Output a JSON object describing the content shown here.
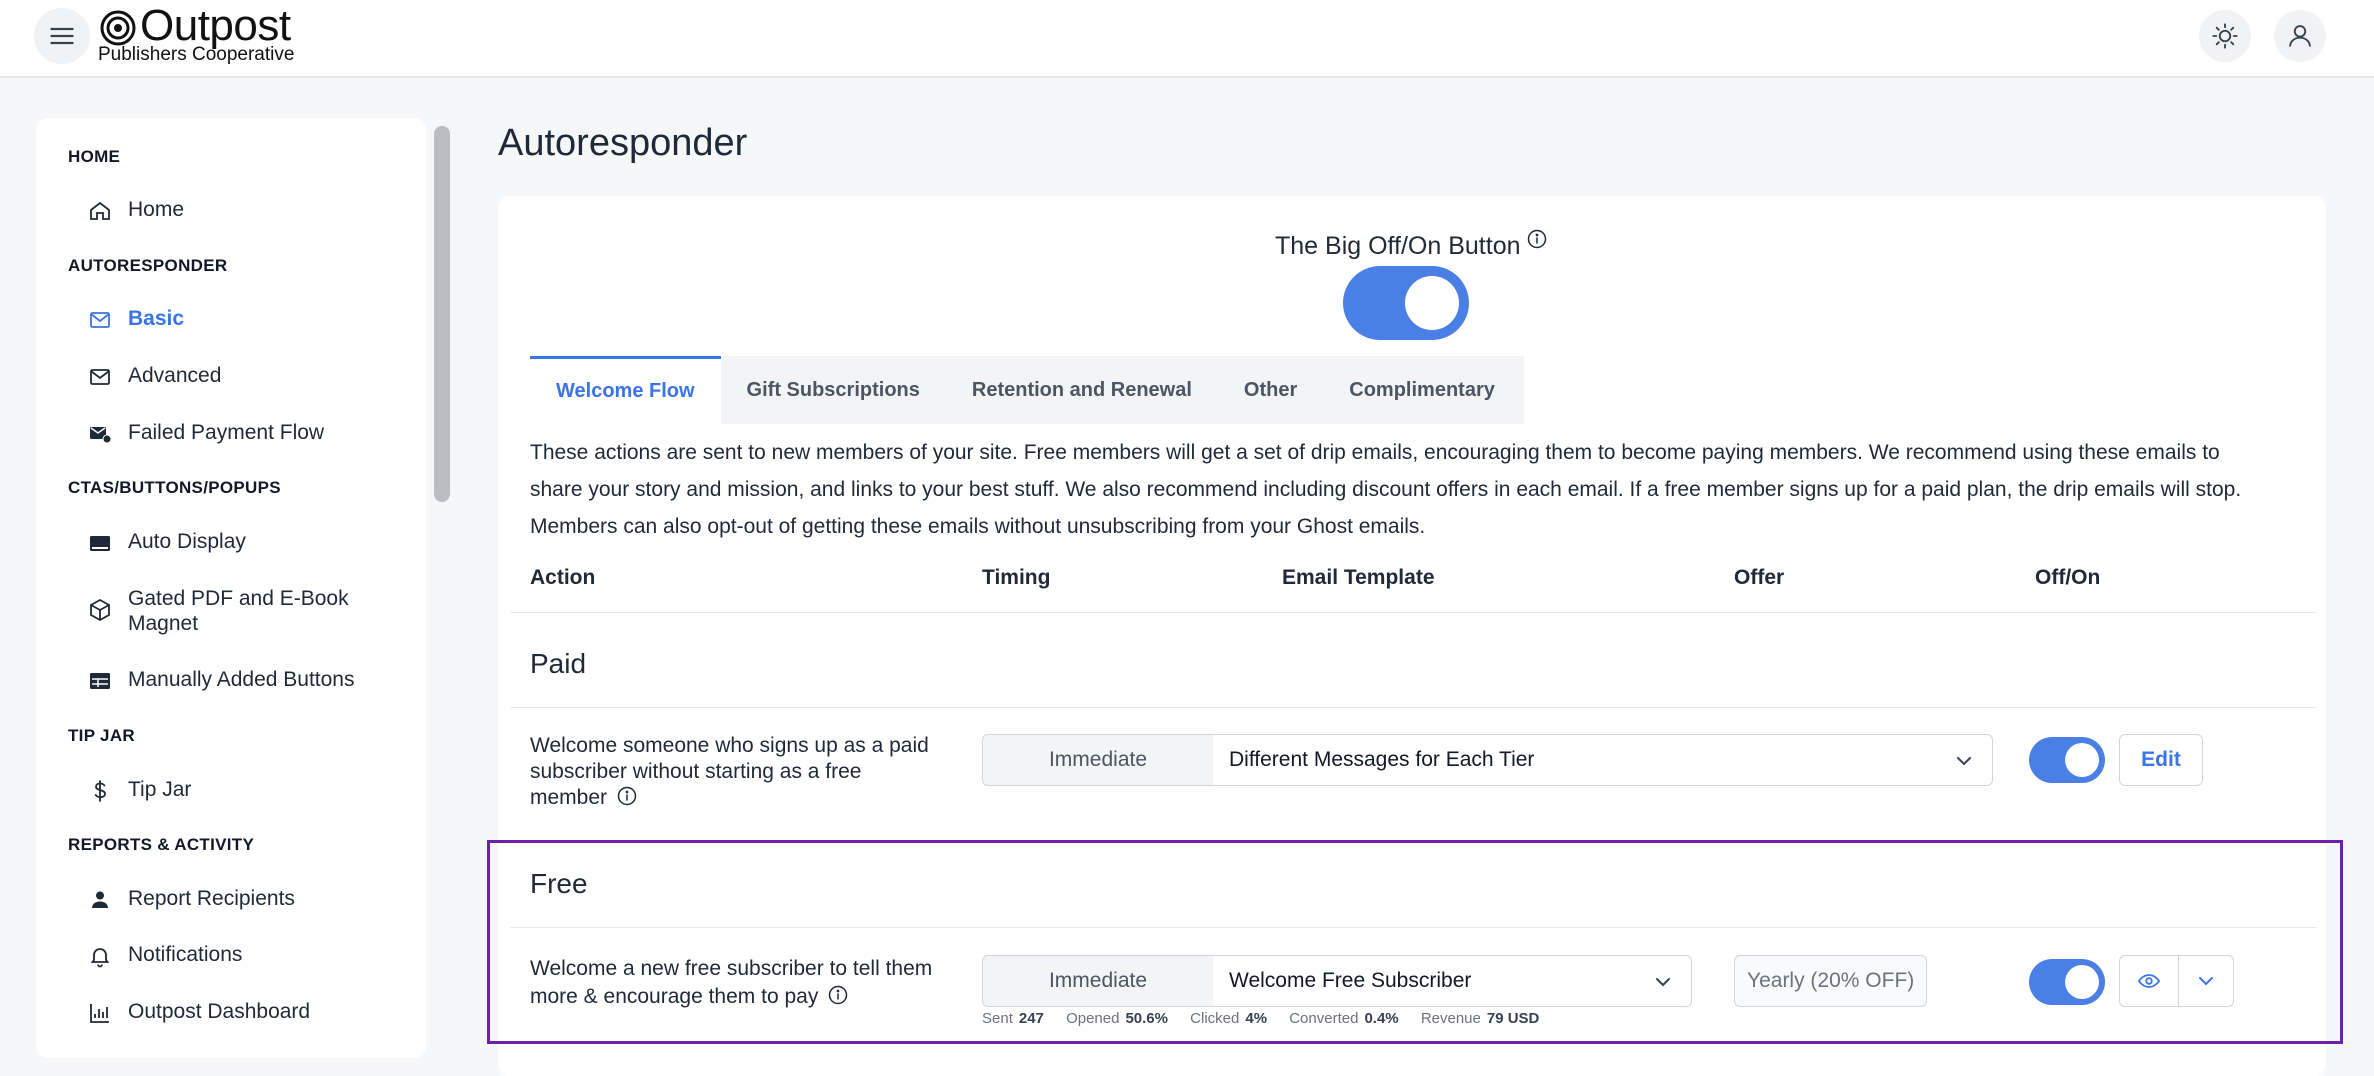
{
  "header": {
    "logo_word": "Outpost",
    "logo_sub": "Publishers Cooperative",
    "icons": [
      "menu-icon",
      "sun-icon",
      "user-icon"
    ]
  },
  "sidebar": {
    "sections": [
      {
        "title": "HOME",
        "items": [
          {
            "label": "Home",
            "icon": "home-icon"
          }
        ]
      },
      {
        "title": "AUTORESPONDER",
        "items": [
          {
            "label": "Basic",
            "icon": "mail-icon",
            "active": true
          },
          {
            "label": "Advanced",
            "icon": "mail-icon"
          },
          {
            "label": "Failed Payment Flow",
            "icon": "mail-alert-icon"
          }
        ]
      },
      {
        "title": "CTAS/BUTTONS/POPUPS",
        "items": [
          {
            "label": "Auto Display",
            "icon": "window-icon"
          },
          {
            "label": "Gated PDF and E-Book Magnet",
            "icon": "box-icon"
          },
          {
            "label": "Manually Added Buttons",
            "icon": "table-icon"
          }
        ]
      },
      {
        "title": "TIP JAR",
        "items": [
          {
            "label": "Tip Jar",
            "icon": "dollar-icon"
          }
        ]
      },
      {
        "title": "REPORTS & ACTIVITY",
        "items": [
          {
            "label": "Report Recipients",
            "icon": "person-icon"
          },
          {
            "label": "Notifications",
            "icon": "bell-icon"
          },
          {
            "label": "Outpost Dashboard",
            "icon": "chart-icon"
          }
        ]
      }
    ]
  },
  "main": {
    "title": "Autoresponder",
    "big_button_label": "The Big Off/On Button",
    "big_button_on": true,
    "tabs": [
      "Welcome Flow",
      "Gift Subscriptions",
      "Retention and Renewal",
      "Other",
      "Complimentary"
    ],
    "active_tab": "Welcome Flow",
    "description": "These actions are sent to new members of your site. Free members will get a set of drip emails, encouraging them to become paying members. We recommend using these emails to share your story and mission, and links to your best stuff. We also recommend including discount offers in each email. If a free member signs up for a paid plan, the drip emails will stop. Members can also opt-out of getting these emails without unsubscribing from your Ghost emails.",
    "columns": [
      "Action",
      "Timing",
      "Email Template",
      "Offer",
      "Off/On"
    ],
    "groups": [
      {
        "title": "Paid",
        "row": {
          "action": "Welcome someone who signs up as a paid subscriber without starting as a free member",
          "timing": "Immediate",
          "template": "Different Messages for Each Tier",
          "enabled": true,
          "edit_label": "Edit"
        }
      },
      {
        "title": "Free",
        "row": {
          "action": "Welcome a new free subscriber to tell them more & encourage them to pay",
          "timing": "Immediate",
          "template": "Welcome Free Subscriber",
          "offer": "Yearly (20% OFF)",
          "enabled": true,
          "stats": {
            "sent_label": "Sent",
            "sent": "247",
            "opened_label": "Opened",
            "opened": "50.6%",
            "clicked_label": "Clicked",
            "clicked": "4%",
            "converted_label": "Converted",
            "converted": "0.4%",
            "revenue_label": "Revenue",
            "revenue": "79 USD"
          }
        }
      }
    ]
  },
  "colors": {
    "accent": "#3b74e6",
    "toggle_on": "#4a7fe6",
    "highlight_border": "#6b21a8"
  }
}
